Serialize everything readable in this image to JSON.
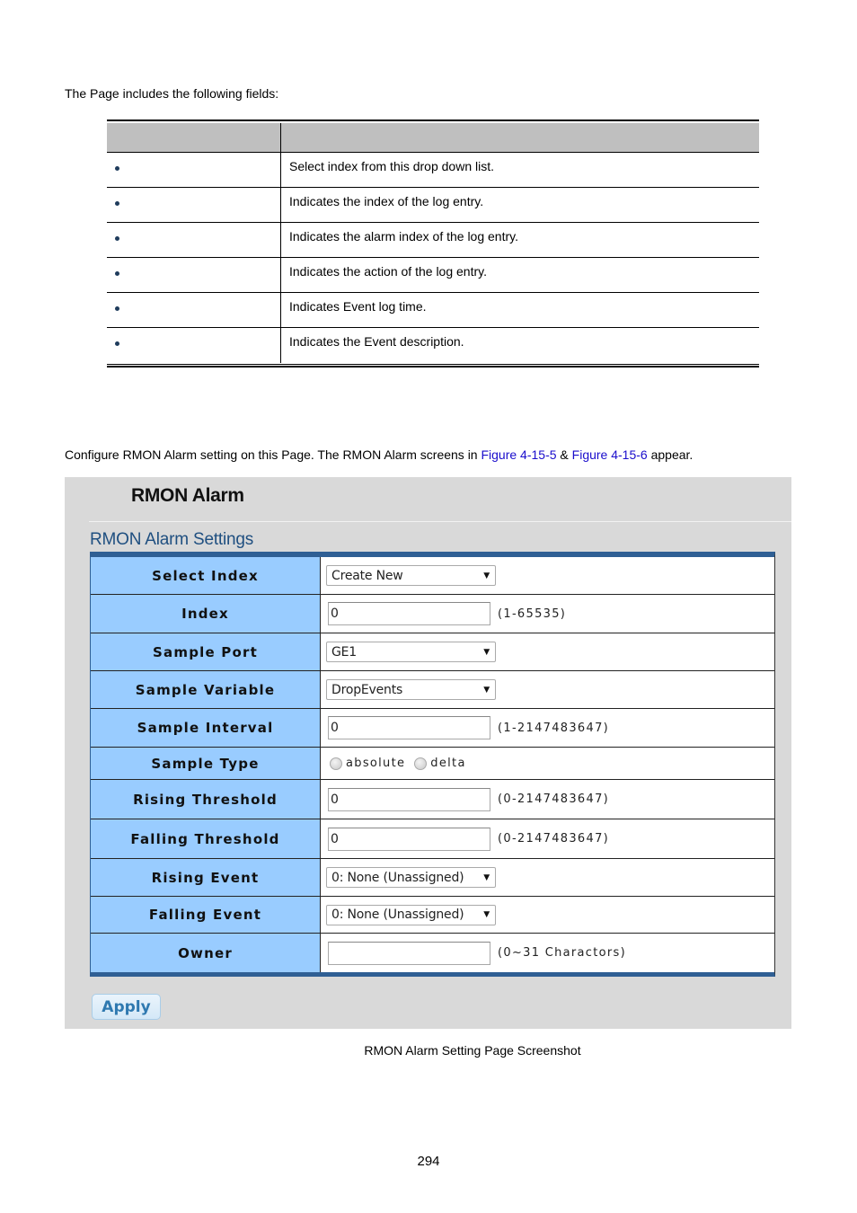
{
  "intro": "The Page includes the following fields:",
  "field_table": {
    "header": [
      "",
      ""
    ],
    "rows": [
      {
        "object": "",
        "description": "Select index from this drop down list."
      },
      {
        "object": "",
        "description": "Indicates the index of the log entry."
      },
      {
        "object": "",
        "description": "Indicates the alarm index of the log entry."
      },
      {
        "object": "",
        "description": "Indicates the action of the log entry."
      },
      {
        "object": "",
        "description": "Indicates Event log time."
      },
      {
        "object": "",
        "description": "Indicates the Event description."
      }
    ]
  },
  "config_text": {
    "before": "Configure RMON Alarm setting on this Page. The RMON Alarm screens in ",
    "link1": "Figure 4-15-5",
    "between": " & ",
    "link2": "Figure 4-15-6",
    "after": " appear."
  },
  "screenshot": {
    "title": "RMON Alarm",
    "section_title": "RMON Alarm Settings",
    "rows": {
      "select_index": {
        "label": "Select Index",
        "value": "Create New"
      },
      "index": {
        "label": "Index",
        "value": "0",
        "hint": "(1-65535)"
      },
      "sample_port": {
        "label": "Sample Port",
        "value": "GE1"
      },
      "sample_variable": {
        "label": "Sample Variable",
        "value": "DropEvents"
      },
      "sample_interval": {
        "label": "Sample Interval",
        "value": "0",
        "hint": "(1-2147483647)"
      },
      "sample_type": {
        "label": "Sample Type",
        "option1": "absolute",
        "option2": "delta"
      },
      "rising_threshold": {
        "label": "Rising Threshold",
        "value": "0",
        "hint": "(0-2147483647)"
      },
      "falling_threshold": {
        "label": "Falling Threshold",
        "value": "0",
        "hint": "(0-2147483647)"
      },
      "rising_event": {
        "label": "Rising Event",
        "value": "0: None (Unassigned)"
      },
      "falling_event": {
        "label": "Falling Event",
        "value": "0: None (Unassigned)"
      },
      "owner": {
        "label": "Owner",
        "value": "",
        "hint": "(0~31 Charactors)"
      }
    },
    "apply_label": "Apply",
    "dropdown_arrow": "▼"
  },
  "caption": "RMON Alarm Setting Page Screenshot",
  "page_number": "294"
}
